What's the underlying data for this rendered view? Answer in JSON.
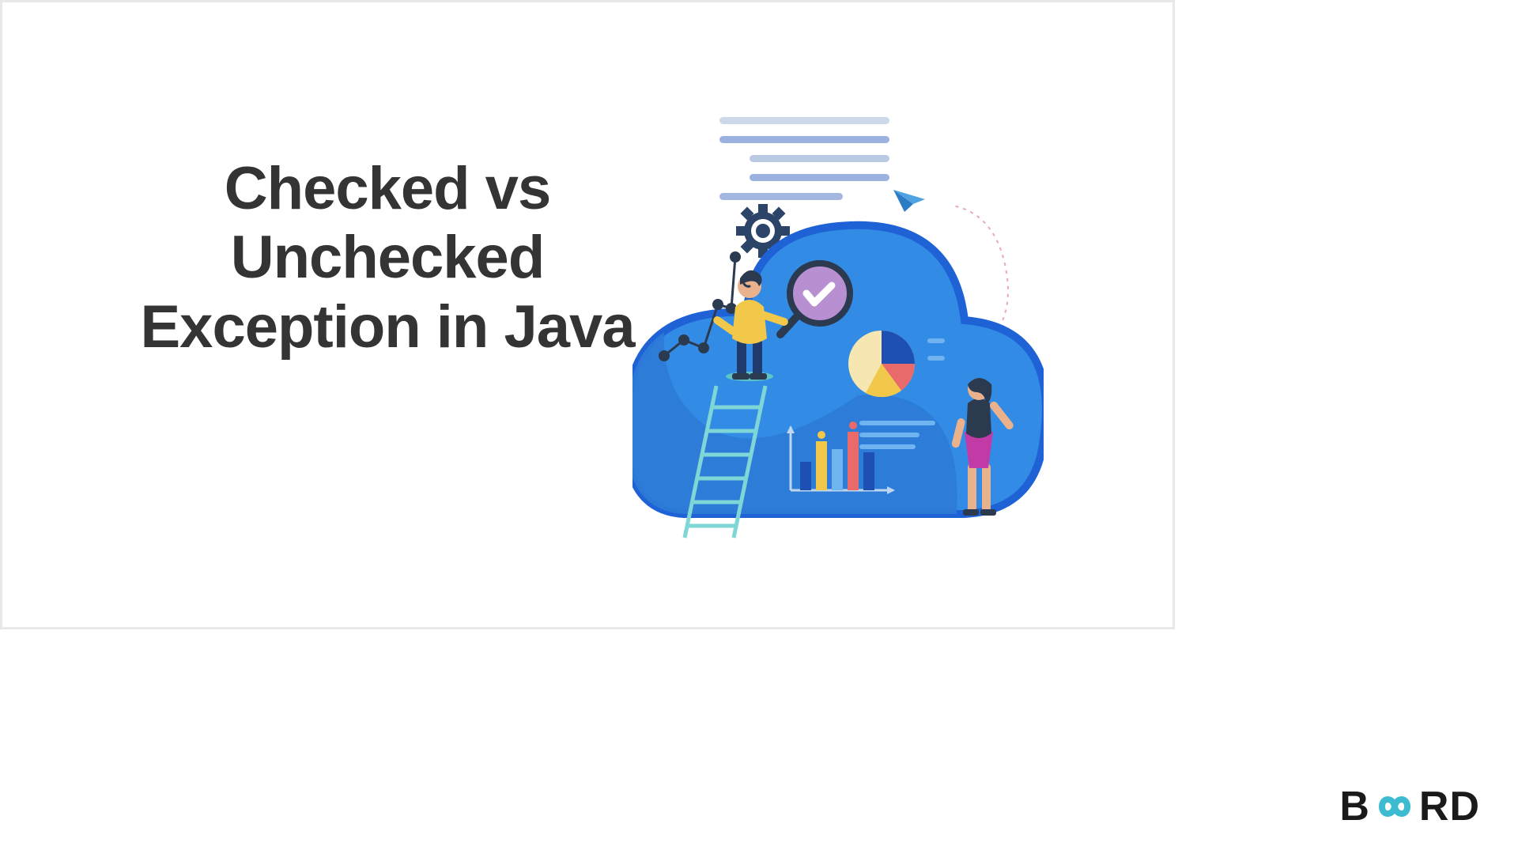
{
  "title": {
    "line1": "Checked vs",
    "line2": "Unchecked",
    "line3": "Exception in Java"
  },
  "logo": {
    "part1": "B",
    "part2": "RD",
    "infinity_color": "#3DBBD1"
  },
  "colors": {
    "text": "#343434",
    "cloud_fill": "#328CE6",
    "cloud_edge": "#1E62D6",
    "gear": "#2B4468",
    "plane": "#4FA3E3",
    "dash": "#E6A6C5",
    "check_bg": "#B88FD1",
    "check_mark": "#FFFFFF",
    "pie1": "#1E4FB2",
    "pie2": "#E86A6A",
    "pie3": "#F2C84B",
    "pie4": "#F5E6B2"
  }
}
